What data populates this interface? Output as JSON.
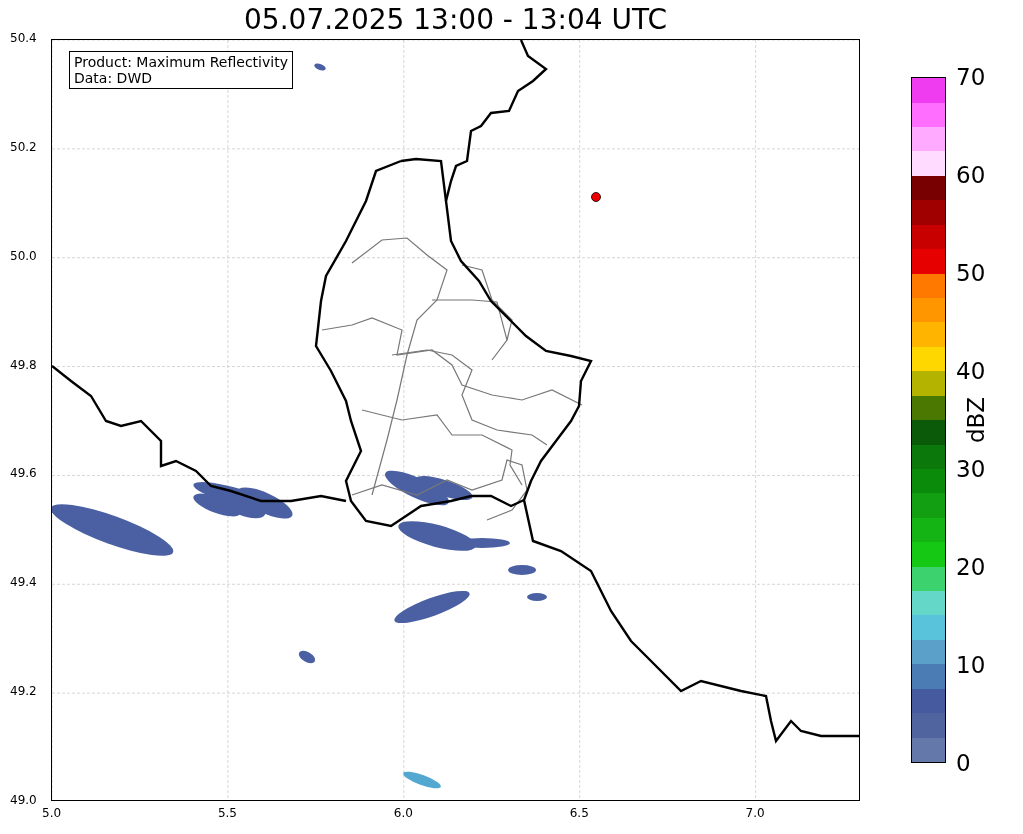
{
  "title": "05.07.2025 13:00 - 13:04 UTC",
  "legend": [
    "Product: Maximum Reflectivity",
    "Data: DWD"
  ],
  "x_ticks": [
    "5.0",
    "5.5",
    "6.0",
    "6.5",
    "7.0"
  ],
  "y_ticks": [
    "50.4",
    "50.2",
    "50.0",
    "49.8",
    "49.6",
    "49.4",
    "49.2",
    "49.0"
  ],
  "colorbar": {
    "label": "dBZ",
    "ticks": [
      "70",
      "60",
      "50",
      "40",
      "30",
      "20",
      "10",
      "0"
    ],
    "segments": [
      {
        "color": "#6478aa"
      },
      {
        "color": "#5064a0"
      },
      {
        "color": "#465aa0"
      },
      {
        "color": "#4b7db4"
      },
      {
        "color": "#5aa0c8"
      },
      {
        "color": "#5ac3dc"
      },
      {
        "color": "#64d7c8"
      },
      {
        "color": "#3cd26e"
      },
      {
        "color": "#14c814"
      },
      {
        "color": "#14b414"
      },
      {
        "color": "#12a012"
      },
      {
        "color": "#0a8c0a"
      },
      {
        "color": "#0a780a"
      },
      {
        "color": "#0a5a0a"
      },
      {
        "color": "#4b7800"
      },
      {
        "color": "#b4b400"
      },
      {
        "color": "#ffd700"
      },
      {
        "color": "#ffb400"
      },
      {
        "color": "#ff9600"
      },
      {
        "color": "#ff7800"
      },
      {
        "color": "#e60000"
      },
      {
        "color": "#c80000"
      },
      {
        "color": "#a00000"
      },
      {
        "color": "#780000"
      },
      {
        "color": "#ffdcff"
      },
      {
        "color": "#ffaaff"
      },
      {
        "color": "#ff6eff"
      },
      {
        "color": "#f03cf0"
      }
    ]
  }
}
